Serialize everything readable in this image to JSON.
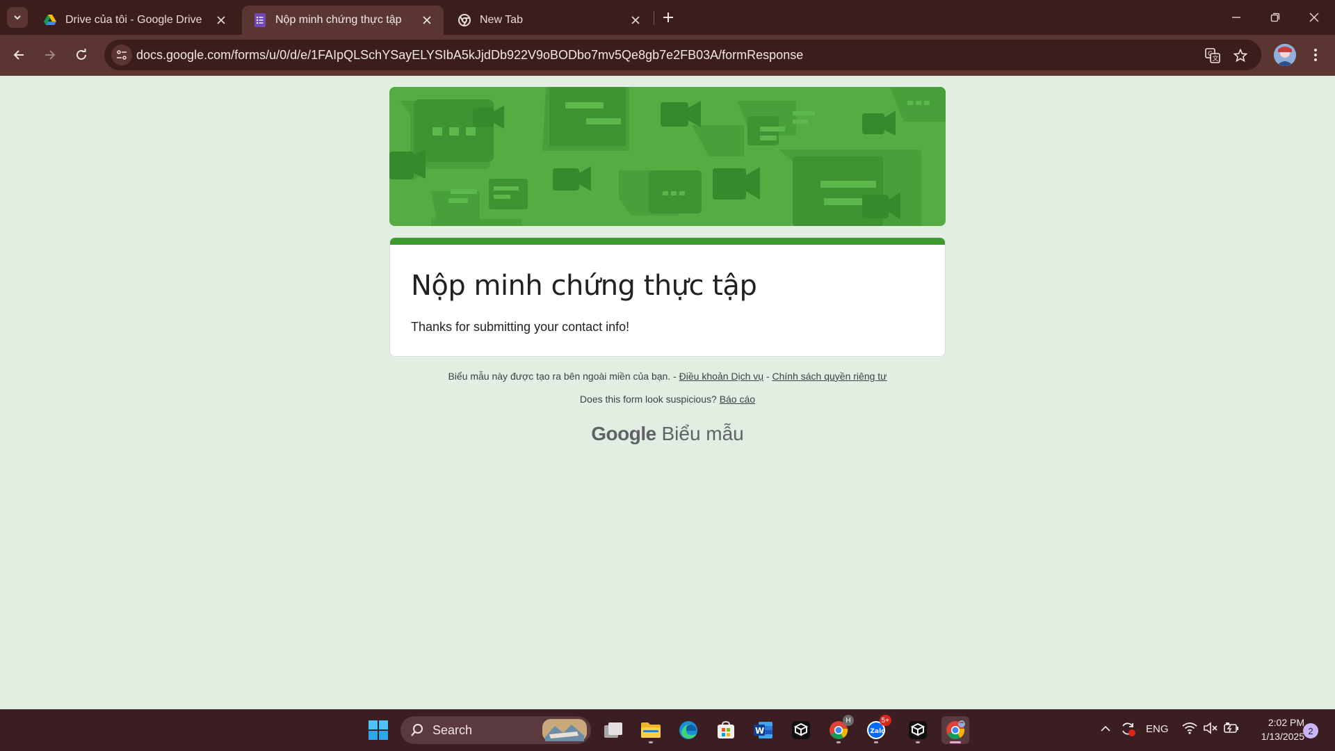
{
  "browser": {
    "tabs": [
      {
        "title": "Drive của tôi - Google Drive",
        "icon": "google-drive-icon",
        "active": false
      },
      {
        "title": "Nộp minh chứng thực tập",
        "icon": "google-forms-icon",
        "active": true
      },
      {
        "title": "New Tab",
        "icon": "chrome-icon",
        "active": false
      }
    ],
    "url": "docs.google.com/forms/u/0/d/e/1FAIpQLSchYSayELYSIbA5kJjdDb922V9oBODbo7mv5Qe8gb7e2FB03A/formResponse"
  },
  "form": {
    "title": "Nộp minh chứng thực tập",
    "message": "Thanks for submitting your contact info!",
    "accent_color": "#3e9a2f",
    "banner_color": "#54ac43"
  },
  "footer": {
    "notice": "Biểu mẫu này được tạo ra bên ngoài miền của bạn. -",
    "terms": "Điều khoản Dịch vụ",
    "sep": "-",
    "privacy": "Chính sách quyền riêng tư",
    "suspicious": "Does this form look suspicious?",
    "report": "Báo cáo",
    "brand_google": "Google",
    "brand_forms": "Biểu mẫu"
  },
  "taskbar": {
    "search_label": "Search",
    "chrome_badge": "H",
    "zalo_badge": "5+",
    "zalo_label": "Zalo",
    "language": "ENG",
    "time": "2:02 PM",
    "date": "1/13/2025",
    "notifications": "2"
  }
}
